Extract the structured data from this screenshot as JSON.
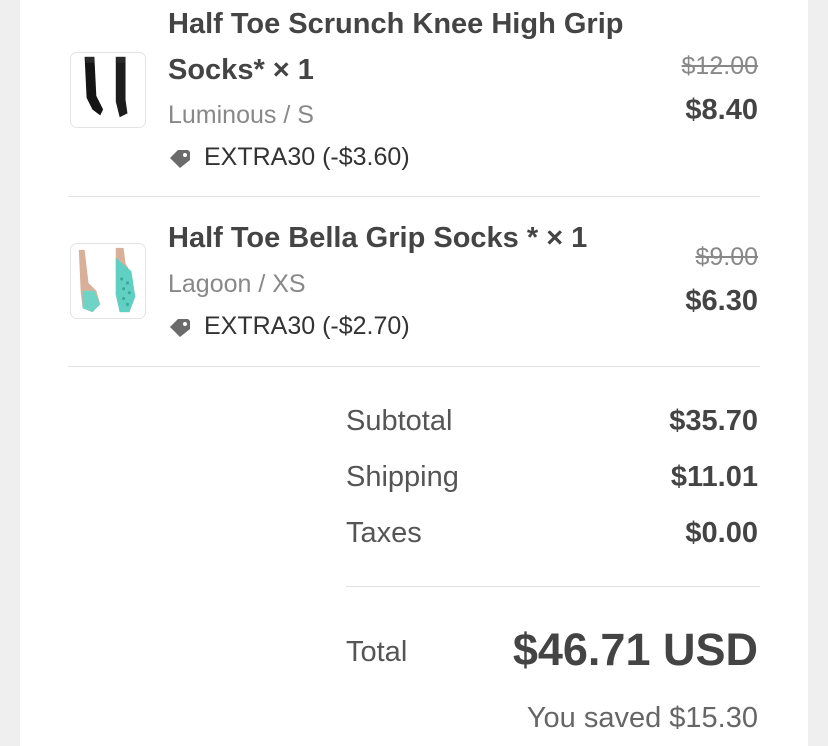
{
  "colors": {
    "text": "#444444",
    "muted": "#888888",
    "divider": "#e2e2e2",
    "thumb_border": "#e3e3e3"
  },
  "items": [
    {
      "title_line1": "Half Toe Scrunch Knee High Grip",
      "title_line2": "Socks* × 1",
      "variant": "Luminous / S",
      "discount": "EXTRA30 (-$3.60)",
      "original_price": "$12.00",
      "price": "$8.40",
      "image_icon": "black-knee-socks-image"
    },
    {
      "title": "Half Toe Bella Grip Socks * × 1",
      "variant": "Lagoon / XS",
      "discount": "EXTRA30 (-$2.70)",
      "original_price": "$9.00",
      "price": "$6.30",
      "image_icon": "teal-grip-socks-image"
    }
  ],
  "summary": {
    "subtotal_label": "Subtotal",
    "subtotal_value": "$35.70",
    "shipping_label": "Shipping",
    "shipping_value": "$11.01",
    "taxes_label": "Taxes",
    "taxes_value": "$0.00",
    "total_label": "Total",
    "total_value": "$46.71 USD",
    "saved_text": "You saved $15.30"
  }
}
